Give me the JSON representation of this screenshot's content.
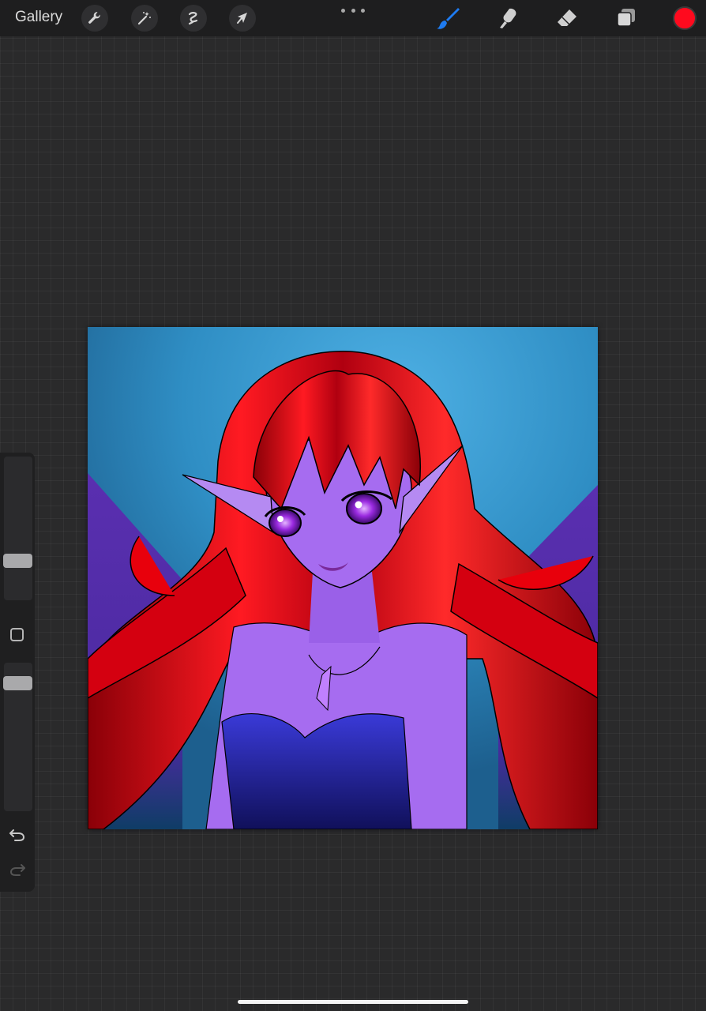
{
  "toolbar": {
    "gallery_label": "Gallery",
    "icons": [
      "wrench-icon",
      "magic-wand-icon",
      "selection-icon",
      "transform-arrow-icon",
      "more-icon",
      "brush-icon",
      "smudge-icon",
      "eraser-icon",
      "layers-icon"
    ],
    "active_tool": "brush",
    "accent_color": "#1e7bf0",
    "current_color": "#ff0a1e"
  },
  "sidebar": {
    "brush_size_level": 0.25,
    "opacity_level": 0.9,
    "icons": [
      "modify-square-icon",
      "undo-icon",
      "redo-icon"
    ]
  },
  "canvas": {
    "artwork": "elf-girl-red-hair",
    "colors": {
      "background_top": "#3ea2d6",
      "background_side": "#5a2fb0",
      "hair": "#e8000c",
      "skin": "#a66cf0",
      "dress": "#2a2aa8"
    }
  }
}
